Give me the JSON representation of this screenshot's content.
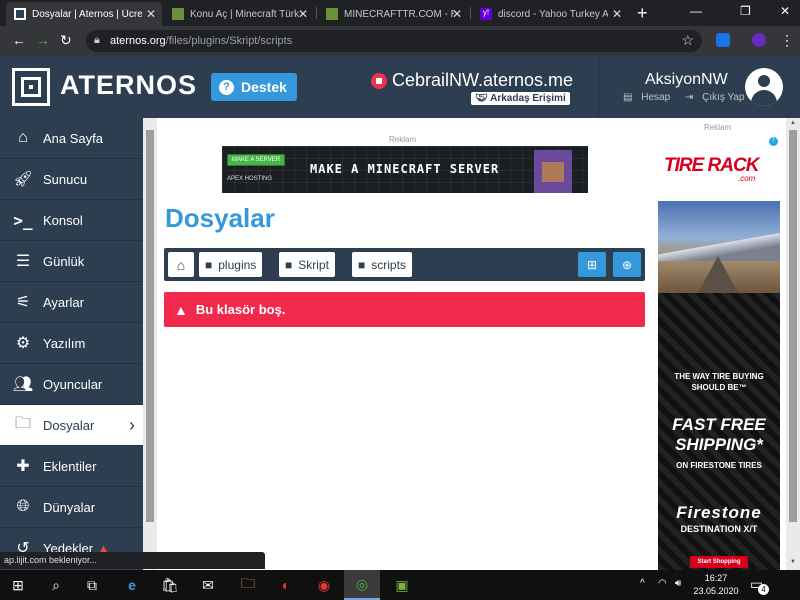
{
  "browser": {
    "tabs": [
      {
        "title": "Dosyalar | Aternos | Ücretsiz",
        "active": true
      },
      {
        "title": "Konu Aç | Minecraft Türk",
        "active": false
      },
      {
        "title": "MİNECRAFTTR.COM - Re",
        "active": false
      },
      {
        "title": "discord - Yahoo Turkey A",
        "active": false
      }
    ],
    "url_host": "aternos.org",
    "url_path": "/files/plugins/Skript/scripts"
  },
  "header": {
    "logo_text": "ATERNOS",
    "support_label": "Destek",
    "server_name": "CebrailNW.aternos.me",
    "friend_access_label": "Arkadaş Erişimi",
    "username": "AksiyonNW",
    "account_label": "Hesap",
    "logout_label": "Çıkış Yap"
  },
  "sidebar": {
    "items": [
      {
        "label": "Ana Sayfa",
        "icon": "home-icon"
      },
      {
        "label": "Sunucu",
        "icon": "rocket-icon"
      },
      {
        "label": "Konsol",
        "icon": "terminal-icon"
      },
      {
        "label": "Günlük",
        "icon": "log-icon"
      },
      {
        "label": "Ayarlar",
        "icon": "sliders-icon"
      },
      {
        "label": "Yazılım",
        "icon": "cogs-icon"
      },
      {
        "label": "Oyuncular",
        "icon": "users-icon"
      },
      {
        "label": "Dosyalar",
        "icon": "folder-icon"
      },
      {
        "label": "Eklentiler",
        "icon": "puzzle-icon"
      },
      {
        "label": "Dünyalar",
        "icon": "globe-icon"
      },
      {
        "label": "Yedekler",
        "icon": "backup-icon"
      }
    ]
  },
  "main": {
    "ad_label": "Reklam",
    "banner": {
      "button": "MAKE A SERVER",
      "brand": "APEX HOSTING",
      "headline": "MAKE A MINECRAFT SERVER"
    },
    "title": "Dosyalar",
    "breadcrumbs": [
      "plugins",
      "Skript",
      "scripts"
    ],
    "alert": "Bu klasör boş."
  },
  "right_ad": {
    "label": "Reklam",
    "brand": "TIRE RACK",
    "brand_suffix": ".com",
    "tagline": "THE WAY TIRE BUYING SHOULD BE™",
    "headline": "FAST FREE SHIPPING*",
    "subline": "ON FIRESTONE TIRES",
    "product_brand": "Firestone",
    "product": "DESTINATION X/T",
    "cta": "Start Shopping"
  },
  "status_bubble": "ap.lijit.com bekleniyor...",
  "taskbar": {
    "time": "16:27",
    "date": "23.05.2020",
    "notifications": "4"
  }
}
